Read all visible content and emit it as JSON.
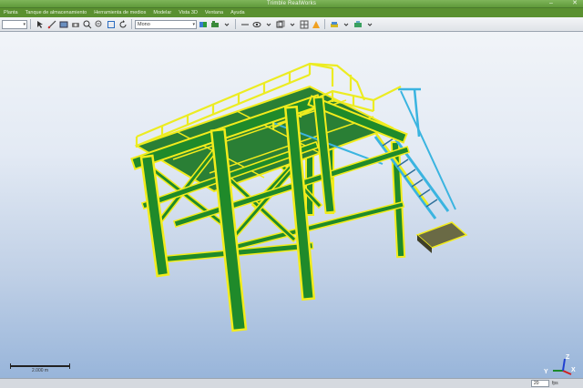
{
  "window": {
    "title": "Trimble RealWorks"
  },
  "menu": {
    "items": [
      "Planta",
      "Tanque de almacenamiento",
      "Herramienta de medios",
      "Modelar",
      "Vista 3D",
      "Ventana",
      "Ayuda"
    ]
  },
  "toolbar": {
    "left_combo_value": "",
    "mode_combo_value": "Mono"
  },
  "scene": {
    "structure_colors": {
      "beams": "#1f8a2a",
      "outline": "#f2ec1c",
      "railings": "#ecec22",
      "stairs": "#3ab4e0",
      "platform": "#5a5a3a"
    }
  },
  "scalebar": {
    "label": "2.000 m"
  },
  "axes": {
    "x_label": "X",
    "y_label": "Y",
    "z_label": "Z"
  },
  "statusbar": {
    "value": "20",
    "unit": "fps"
  }
}
